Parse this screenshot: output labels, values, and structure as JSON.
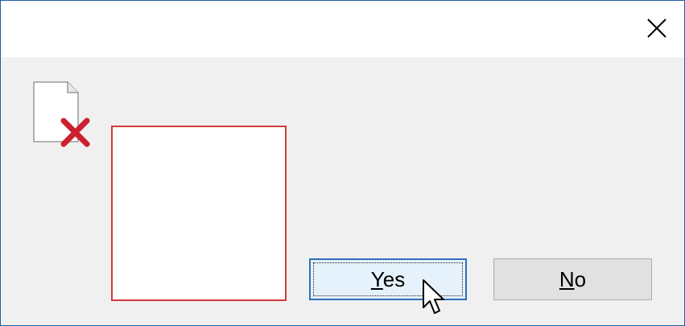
{
  "window": {
    "close_icon": "close-icon"
  },
  "icons": {
    "file": "file-icon",
    "error": "red-x-icon",
    "cursor": "mouse-pointer-icon"
  },
  "buttons": {
    "yes": {
      "access_key": "Y",
      "rest": "es"
    },
    "no": {
      "access_key": "N",
      "rest": "o"
    }
  },
  "colors": {
    "title_bar": "#ffffff",
    "body": "#f0f0f0",
    "window_border": "#1f5ea8",
    "preview_border": "#d43a3a",
    "yes_button_bg": "#e5f1fb",
    "yes_button_border": "#2e6fb8",
    "no_button_bg": "#e1e1e1",
    "error_x": "#cc1f2f"
  }
}
